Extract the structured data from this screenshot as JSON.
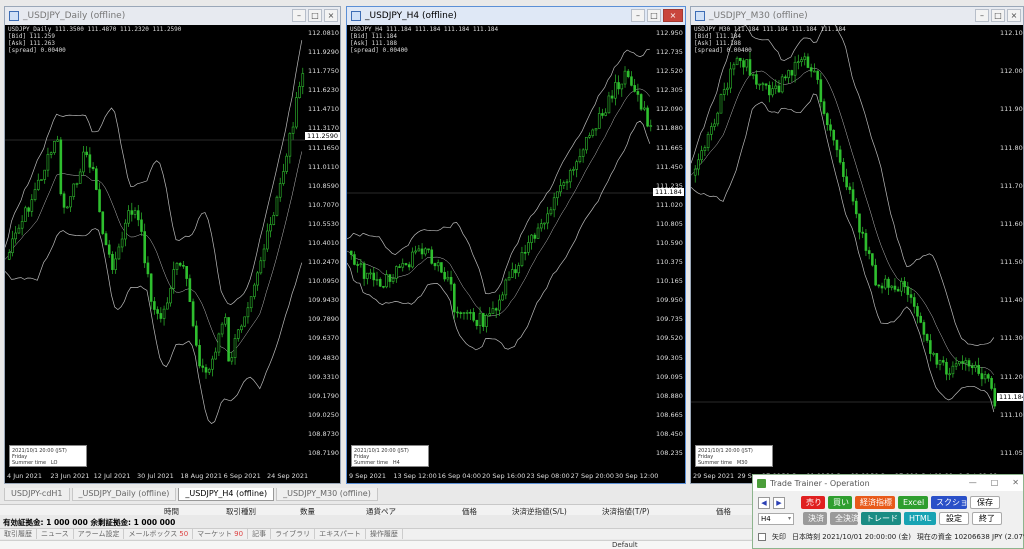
{
  "charts": [
    {
      "title": "_USDJPY_Daily (offline)",
      "info": "USDJPY_Daily 111.3500 111.4870 111.2320 111.2590\n[Bid] 111.259\n[Ask] 111.263\n[spread] 0.00400",
      "price": "111.2590",
      "yticks": [
        "112.0810",
        "111.9290",
        "111.7750",
        "111.6230",
        "111.4710",
        "111.3170",
        "111.1650",
        "111.0110",
        "110.8590",
        "110.7070",
        "110.5530",
        "110.4010",
        "110.2470",
        "110.0950",
        "109.9430",
        "109.7890",
        "109.6370",
        "109.4830",
        "109.3310",
        "109.1790",
        "109.0250",
        "108.8730",
        "108.7190"
      ],
      "xticks": [
        "4 Jun 2021",
        "23 Jun 2021",
        "12 Jul 2021",
        "30 Jul 2021",
        "18 Aug 2021",
        "6 Sep 2021",
        "24 Sep 2021"
      ],
      "minibox": "2021/10/1 20:00 (JST)\nFriday\nSummer time   LO"
    },
    {
      "title": "_USDJPY_H4 (offline)",
      "info": "USDJPY_H4 111.184 111.184 111.184 111.184\n[Bid] 111.184\n[Ask] 111.188\n[spread] 0.00400",
      "price": "111.184",
      "yticks": [
        "112.950",
        "112.735",
        "112.520",
        "112.305",
        "112.090",
        "111.880",
        "111.665",
        "111.450",
        "111.235",
        "111.020",
        "110.805",
        "110.590",
        "110.375",
        "110.165",
        "109.950",
        "109.735",
        "109.520",
        "109.305",
        "109.095",
        "108.880",
        "108.665",
        "108.450",
        "108.235"
      ],
      "xticks": [
        "9 Sep 2021",
        "13 Sep 12:00",
        "16 Sep 04:00",
        "20 Sep 16:00",
        "23 Sep 08:00",
        "27 Sep 20:00",
        "30 Sep 12:00"
      ],
      "minibox": "2021/10/1 20:00 (JST)\nFriday\nSummer time   H4"
    },
    {
      "title": "_USDJPY_M30 (offline)",
      "info": "USDJPY_M30 111.184 111.184 111.184 111.184\n[Bid] 111.184\n[Ask] 111.188\n[spread] 0.00400",
      "price": "111.184",
      "yticks": [
        "112.100",
        "112.000",
        "111.900",
        "111.800",
        "111.700",
        "111.600",
        "111.500",
        "111.400",
        "111.300",
        "111.200",
        "111.100",
        "111.050"
      ],
      "xticks": [
        "29 Sep 2021",
        "29 Sep 17:00",
        "30 Sep 01:00",
        "30 Sep 09:00",
        "30 Sep 17:00",
        "1 Oct 01:00",
        "1 Oct 09:00"
      ],
      "minibox": "2021/10/1 20:00 (JST)\nFriday\nSummer time   M30"
    }
  ],
  "tabs": [
    "USDJPY-cdH1",
    "_USDJPY_Daily (offline)",
    "_USDJPY_H4 (offline)",
    "_USDJPY_M30 (offline)"
  ],
  "terminal": {
    "headers": [
      "時間",
      "取引種別",
      "数量",
      "通貨ペア",
      "価格",
      "決済逆指値(S/L)",
      "決済指値(T/P)",
      "価格"
    ],
    "balance": "有効証拠金: 1 000 000  余剰証拠金: 1 000 000",
    "bottom_tabs": [
      {
        "label": "取引履歴",
        "count": ""
      },
      {
        "label": "ニュース",
        "count": ""
      },
      {
        "label": "アラーム設定",
        "count": ""
      },
      {
        "label": "メールボックス",
        "count": "50"
      },
      {
        "label": "マーケット",
        "count": "90"
      },
      {
        "label": "記事",
        "count": ""
      },
      {
        "label": "ライブラリ",
        "count": ""
      },
      {
        "label": "エキスパート",
        "count": ""
      },
      {
        "label": "操作履歴",
        "count": ""
      }
    ],
    "status": "Default"
  },
  "trainer": {
    "title": "Trade Trainer - Operation",
    "prev": "◀",
    "next": "▶",
    "timeframe": "H4",
    "sell": "売り",
    "buy": "買い",
    "modify": "経済指標",
    "excel": "Excel",
    "screenshot": "スクショ",
    "save": "保存",
    "settle": "決済",
    "settle_all": "全決済",
    "trade": "トレード",
    "html": "HTML",
    "settings": "設定",
    "exit": "終了",
    "arrow_label": "矢印",
    "time_label": "日本時刻 2021/10/01 20:00:00 (金)",
    "funds_label": "現在の資金 10206638 JPY (2.07%)"
  }
}
